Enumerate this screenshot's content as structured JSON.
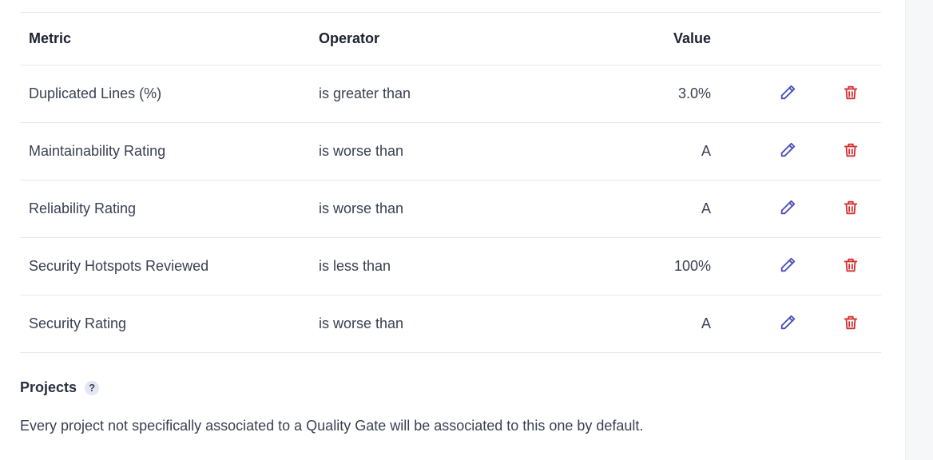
{
  "table": {
    "headers": {
      "metric": "Metric",
      "operator": "Operator",
      "value": "Value"
    },
    "rows": [
      {
        "metric": "Duplicated Lines (%)",
        "operator": "is greater than",
        "value": "3.0%"
      },
      {
        "metric": "Maintainability Rating",
        "operator": "is worse than",
        "value": "A"
      },
      {
        "metric": "Reliability Rating",
        "operator": "is worse than",
        "value": "A"
      },
      {
        "metric": "Security Hotspots Reviewed",
        "operator": "is less than",
        "value": "100%"
      },
      {
        "metric": "Security Rating",
        "operator": "is worse than",
        "value": "A"
      }
    ],
    "edit_icon": "pencil-icon",
    "delete_icon": "trash-icon"
  },
  "projects": {
    "title": "Projects",
    "help_label": "?",
    "description": "Every project not specifically associated to a Quality Gate will be associated to this one by default."
  },
  "colors": {
    "edit_icon": "#4a4fb8",
    "delete_icon": "#d43030",
    "divider": "#e6e8ec",
    "text": "#3a3f52"
  }
}
